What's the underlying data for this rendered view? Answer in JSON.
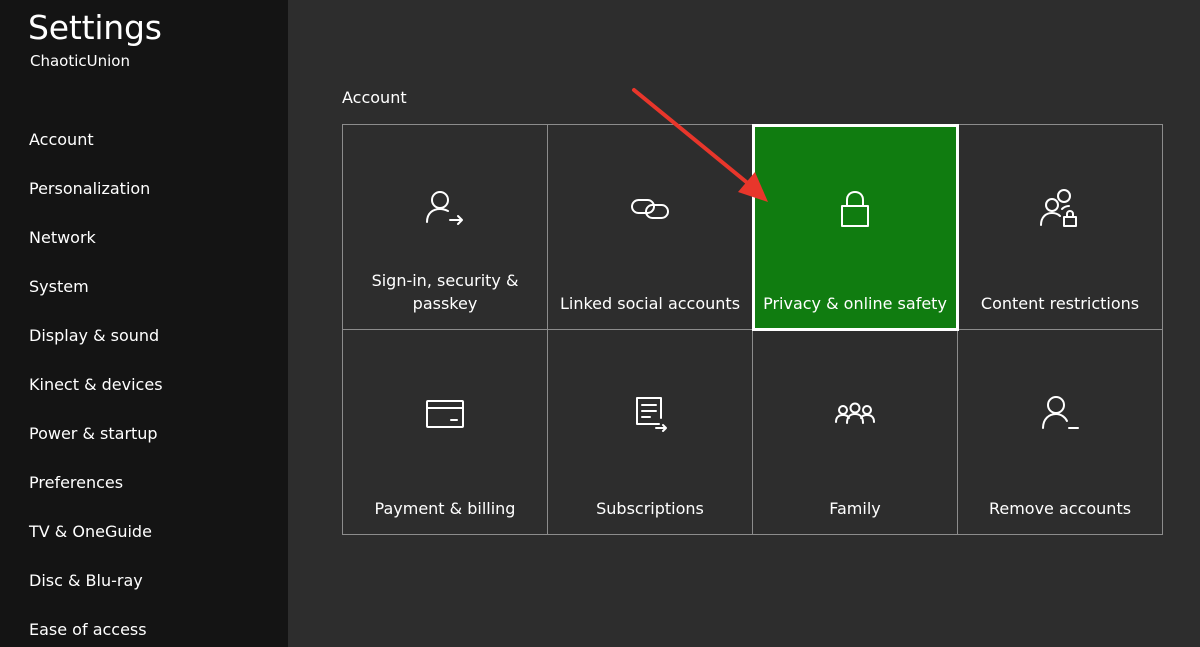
{
  "sidebar": {
    "title": "Settings",
    "gamertag": "ChaoticUnion",
    "items": [
      {
        "label": "Account"
      },
      {
        "label": "Personalization"
      },
      {
        "label": "Network"
      },
      {
        "label": "System"
      },
      {
        "label": "Display & sound"
      },
      {
        "label": "Kinect & devices"
      },
      {
        "label": "Power & startup"
      },
      {
        "label": "Preferences"
      },
      {
        "label": "TV & OneGuide"
      },
      {
        "label": "Disc & Blu-ray"
      },
      {
        "label": "Ease of access"
      }
    ]
  },
  "main": {
    "section_title": "Account",
    "tiles": [
      {
        "label": "Sign-in, security & passkey",
        "icon": "person-arrow-icon"
      },
      {
        "label": "Linked social accounts",
        "icon": "link-icon"
      },
      {
        "label": "Privacy & online safety",
        "icon": "lock-icon",
        "selected": true
      },
      {
        "label": "Content restrictions",
        "icon": "people-lock-icon"
      },
      {
        "label": "Payment & billing",
        "icon": "credit-card-icon"
      },
      {
        "label": "Subscriptions",
        "icon": "subscriptions-icon"
      },
      {
        "label": "Family",
        "icon": "family-icon"
      },
      {
        "label": "Remove accounts",
        "icon": "person-remove-icon"
      }
    ]
  },
  "colors": {
    "sidebar_bg": "#141414",
    "main_bg": "#2d2d2d",
    "selected_tile": "#107c10",
    "annotation_arrow": "#e8362b"
  }
}
